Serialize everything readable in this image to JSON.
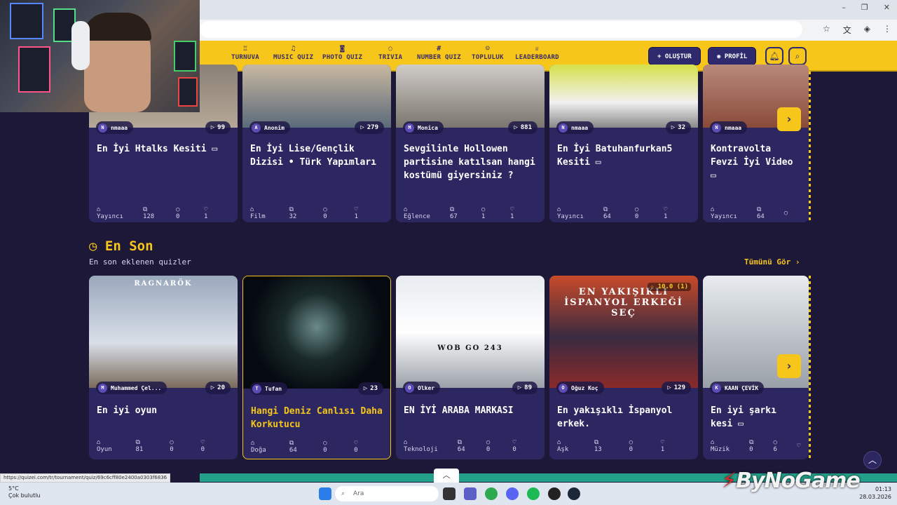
{
  "browser": {
    "status_url": "https://quizei.com/tr/tournament/quiz/69c6cff80e2400a0303f6836"
  },
  "nav": {
    "items": [
      {
        "label": "TURNUVA",
        "icon": "trophy-icon",
        "glyph": "♖"
      },
      {
        "label": "MUSIC QUIZ",
        "icon": "music-note-icon",
        "glyph": "♫"
      },
      {
        "label": "PHOTO QUIZ",
        "icon": "camera-icon",
        "glyph": "◙"
      },
      {
        "label": "TRIVIA",
        "icon": "chat-icon",
        "glyph": "◌"
      },
      {
        "label": "NUMBER QUIZ",
        "icon": "hash-icon",
        "glyph": "#"
      },
      {
        "label": "TOPLULUK",
        "icon": "users-icon",
        "glyph": "☺"
      },
      {
        "label": "LEADERBOARD",
        "icon": "crown-icon",
        "glyph": "♕"
      }
    ],
    "create_label": "+ OLUŞTUR",
    "profile_label": "PROFİL"
  },
  "top_row": [
    {
      "author": "nmaaa",
      "author_initial": "N",
      "plays": "99",
      "title": "En İyi Htalks Kesiti ▭",
      "category": "Yayıncı",
      "questions": "128",
      "comments": "0",
      "likes": "1"
    },
    {
      "author": "Anonim",
      "author_initial": "A",
      "plays": "279",
      "title": "En İyi Lise/Gençlik Dizisi • Türk Yapımları",
      "category": "Film",
      "questions": "32",
      "comments": "0",
      "likes": "1"
    },
    {
      "author": "Monica",
      "author_initial": "M",
      "plays": "881",
      "title": "Sevgilinle Hollowen partisine katılsan hangi kostümü giyersiniz ?",
      "category": "Eğlence",
      "questions": "67",
      "comments": "1",
      "likes": "1"
    },
    {
      "author": "nmaaa",
      "author_initial": "N",
      "plays": "32",
      "title": "En İyi Batuhanfurkan5 Kesiti ▭",
      "category": "Yayıncı",
      "questions": "64",
      "comments": "0",
      "likes": "1"
    },
    {
      "author": "nmaaa",
      "author_initial": "N",
      "plays": "",
      "title": "Kontravolta Fevzi İyi Video ▭",
      "category": "Yayıncı",
      "questions": "64",
      "comments": "",
      "likes": ""
    }
  ],
  "latest": {
    "title": "En Son",
    "subtitle": "En son eklenen quizler",
    "see_all": "Tümünü Gör ›",
    "cards": [
      {
        "thumb_text": "RAGNARÖK",
        "author": "Muhammed Çel...",
        "author_initial": "M",
        "plays": "20",
        "title": "En iyi oyun",
        "category": "Oyun",
        "questions": "81",
        "comments": "0",
        "likes": "0",
        "rating": ""
      },
      {
        "thumb_text": "",
        "author": "Tufan",
        "author_initial": "T",
        "plays": "23",
        "title": "Hangi Deniz Canlısı Daha Korkutucu",
        "category": "Doğa",
        "questions": "64",
        "comments": "0",
        "likes": "0",
        "rating": ""
      },
      {
        "thumb_text": "WOB GO 243",
        "author": "Olker",
        "author_initial": "O",
        "plays": "89",
        "title": "EN İYİ ARABA MARKASI",
        "category": "Teknoloji",
        "questions": "64",
        "comments": "0",
        "likes": "0",
        "rating": ""
      },
      {
        "thumb_text": "EN YAKIŞIKLI İSPANYOL ERKEĞİ SEÇ",
        "author": "Oğuz Koç",
        "author_initial": "O",
        "plays": "129",
        "title": "En yakışıklı İspanyol erkek.",
        "category": "Aşk",
        "questions": "13",
        "comments": "0",
        "likes": "1",
        "rating": "☆ 10.0 (1)"
      },
      {
        "thumb_text": "",
        "author": "KAAN ÇEVİK",
        "author_initial": "K",
        "plays": "",
        "title": "En iyi şarkı kesi ▭",
        "category": "Müzik",
        "questions": "0",
        "comments": "6",
        "likes": "",
        "rating": ""
      }
    ]
  },
  "taskbar": {
    "temp": "5°C",
    "weather": "Çok bulutlu",
    "search_placeholder": "Ara",
    "time": "01:13",
    "date": "28.03.2026"
  },
  "watermark": "ByNoGame",
  "colors": {
    "accent": "#f6c61a",
    "background": "#1d1838",
    "card": "#2c2760",
    "nav_btn": "#2f2a6e"
  }
}
